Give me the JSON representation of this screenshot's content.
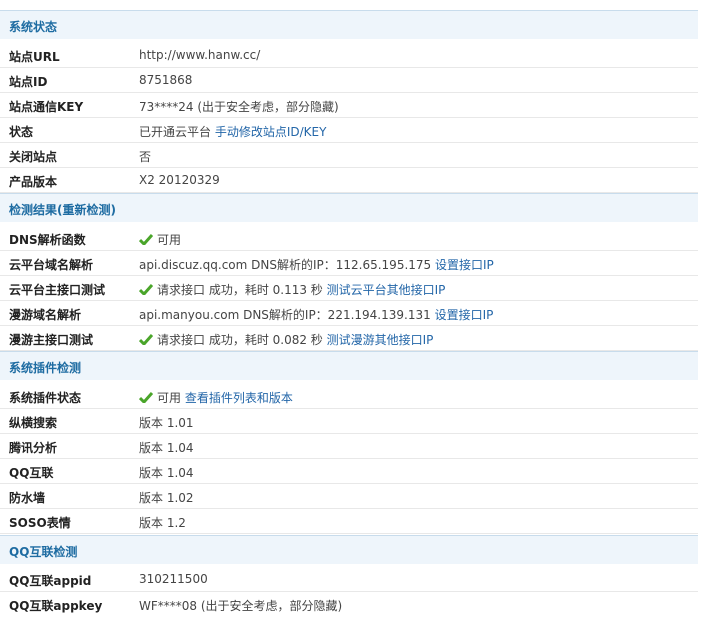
{
  "sections": {
    "system_status": "系统状态",
    "check_result": "检测结果",
    "recheck_link": "(重新检测)",
    "plugin_check": "系统插件检测",
    "qq_check": "QQ互联检测"
  },
  "system": {
    "site_url_label": "站点URL",
    "site_url_value": "http://www.hanw.cc/",
    "site_id_label": "站点ID",
    "site_id_value": "8751868",
    "site_key_label": "站点通信KEY",
    "site_key_value": "73****24 (出于安全考虑，部分隐藏)",
    "status_label": "状态",
    "status_value": "已开通云平台",
    "status_link": "手动修改站点ID/KEY",
    "closed_label": "关闭站点",
    "closed_value": "否",
    "version_label": "产品版本",
    "version_value": "X2 20120329"
  },
  "check": {
    "dns_label": "DNS解析函数",
    "dns_value": "可用",
    "cloud_domain_label": "云平台域名解析",
    "cloud_domain_value": "api.discuz.qq.com DNS解析的IP：112.65.195.175",
    "cloud_domain_link": "设置接口IP",
    "cloud_api_label": "云平台主接口测试",
    "cloud_api_value": "请求接口 成功，耗时 0.113 秒",
    "cloud_api_link": "测试云平台其他接口IP",
    "manyou_domain_label": "漫游域名解析",
    "manyou_domain_value": "api.manyou.com DNS解析的IP：221.194.139.131",
    "manyou_domain_link": "设置接口IP",
    "manyou_api_label": "漫游主接口测试",
    "manyou_api_value": "请求接口 成功，耗时 0.082 秒",
    "manyou_api_link": "测试漫游其他接口IP"
  },
  "plugins": {
    "plugin_status_label": "系统插件状态",
    "plugin_status_value": "可用",
    "plugin_status_link": "查看插件列表和版本",
    "search_label": "纵横搜索",
    "search_value": "版本 1.01",
    "stats_label": "腾讯分析",
    "stats_value": "版本 1.04",
    "qq_label": "QQ互联",
    "qq_value": "版本 1.04",
    "firewall_label": "防水墙",
    "firewall_value": "版本 1.02",
    "soso_label": "SOSO表情",
    "soso_value": "版本 1.2"
  },
  "qq": {
    "appid_label": "QQ互联appid",
    "appid_value": "310211500",
    "appkey_label": "QQ互联appkey",
    "appkey_value": "WF****08 (出于安全考虑，部分隐藏)"
  },
  "colors": {
    "section_bg": "#eef5fb",
    "section_title": "#1e6ca2",
    "link": "#2366a8",
    "check_green": "#4aa52a"
  }
}
